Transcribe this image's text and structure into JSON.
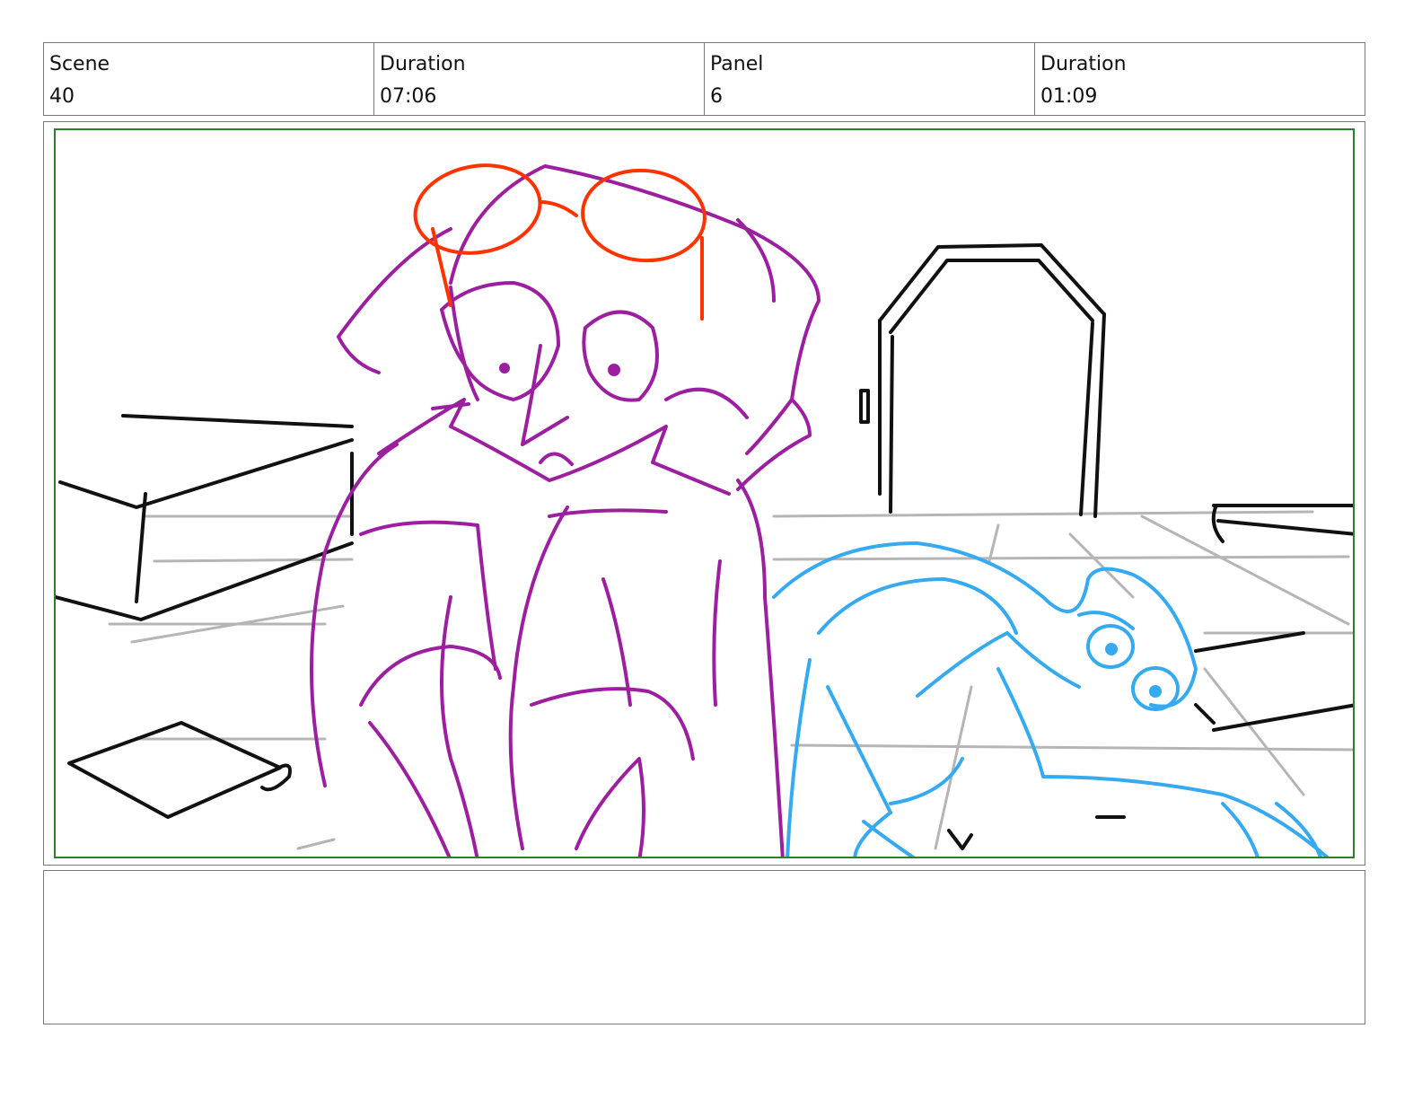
{
  "header": {
    "scene_label": "Scene",
    "scene_value": "40",
    "scene_duration_label": "Duration",
    "scene_duration_value": "07:06",
    "panel_label": "Panel",
    "panel_value": "6",
    "panel_duration_label": "Duration",
    "panel_duration_value": "01:09"
  },
  "notes": {
    "text": ""
  },
  "colors": {
    "frame_border": "#2e7d32",
    "character_one": "#9c1fa0",
    "goggles": "#ff3300",
    "character_two": "#35aaf0",
    "background_lines": "#111111",
    "floor_lines": "#b5b5b5"
  },
  "icons": {
    "sketch": "storyboard-sketch-drawing"
  }
}
